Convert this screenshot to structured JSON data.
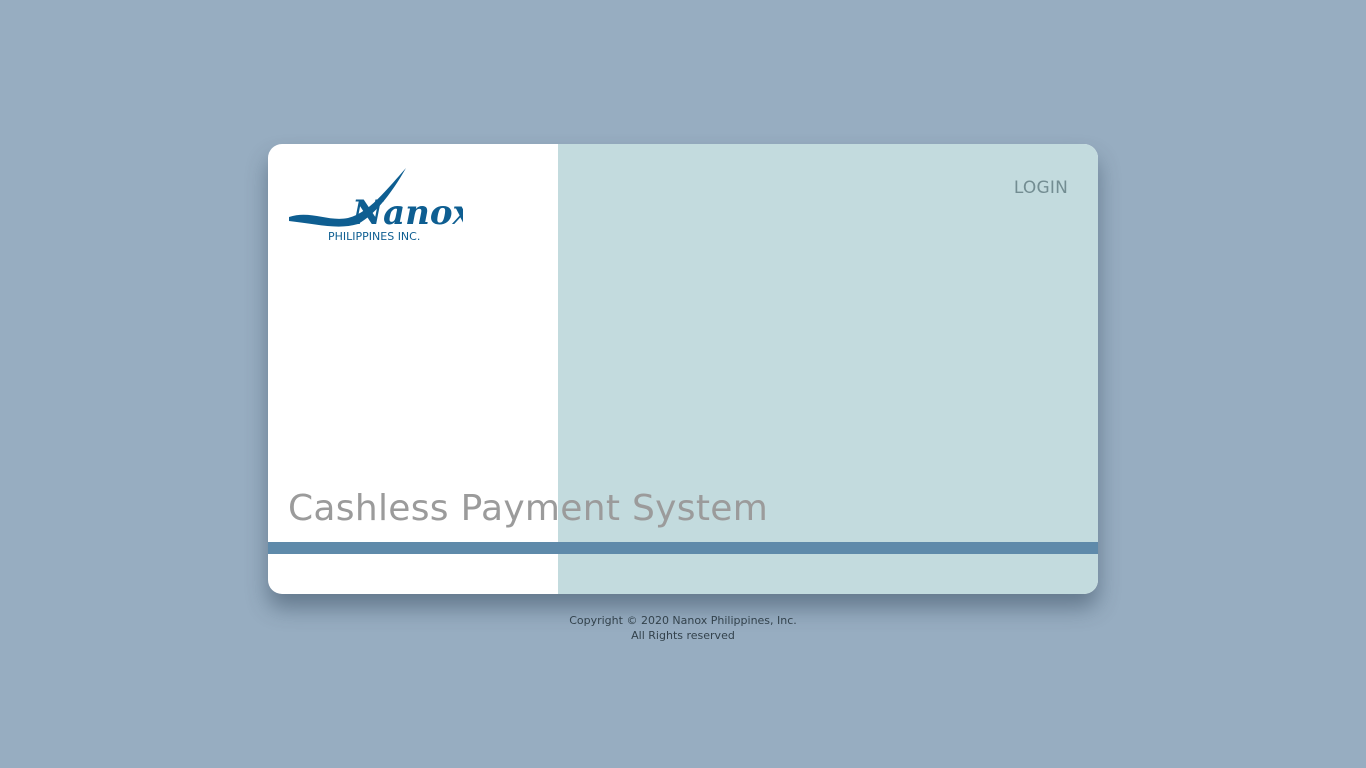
{
  "brand": {
    "name": "Nanox",
    "subtitle": "PHILIPPINES INC."
  },
  "nav": {
    "login_label": "LOGIN"
  },
  "hero": {
    "title": "Cashless Payment System"
  },
  "footer": {
    "copyright": "Copyright © 2020 Nanox Philippines, Inc.",
    "rights": "All Rights reserved"
  },
  "colors": {
    "page_background": "#97adc1",
    "card_left": "#ffffff",
    "card_right": "#c3dbde",
    "stripe": "#5f8aaa",
    "brand_blue": "#0e5e91",
    "title_text": "#9b9b9b",
    "login_text": "#738d92"
  }
}
